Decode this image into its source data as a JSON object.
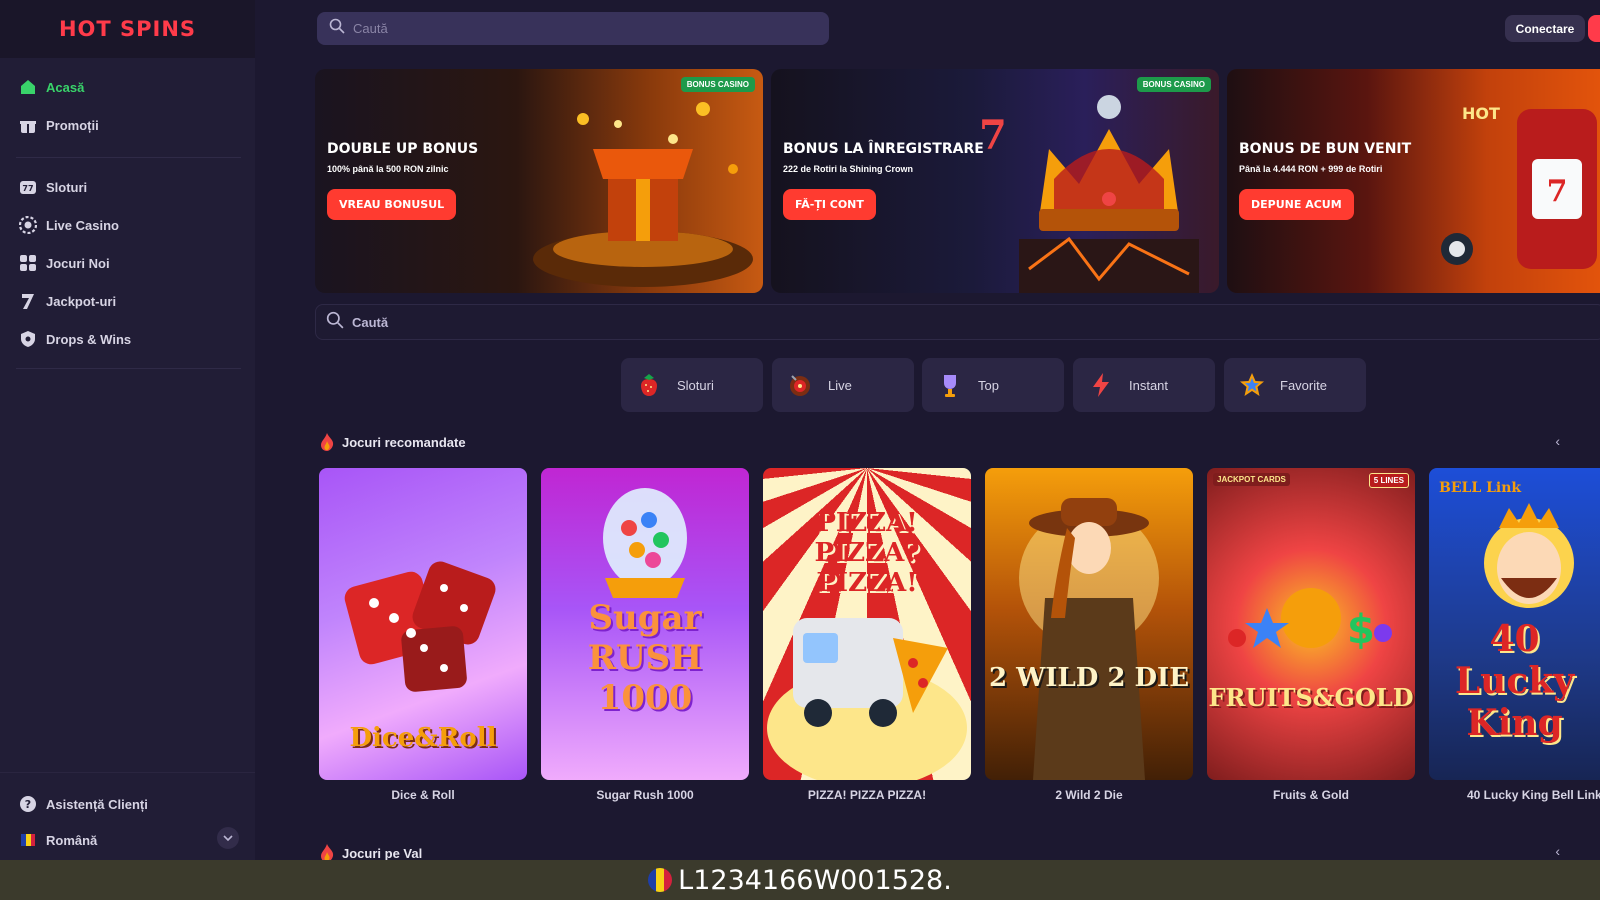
{
  "brand": {
    "logo_text": "HOT SPINS"
  },
  "topbar": {
    "search_placeholder": "Caută",
    "login_label": "Conectare"
  },
  "sidebar": {
    "items_top": [
      {
        "label": "Acasă",
        "icon": "home-icon",
        "active": true
      },
      {
        "label": "Promoții",
        "icon": "gift-icon",
        "active": false
      }
    ],
    "items_games": [
      {
        "label": "Sloturi",
        "icon": "slot-machine-icon"
      },
      {
        "label": "Live Casino",
        "icon": "chip-icon"
      },
      {
        "label": "Jocuri Noi",
        "icon": "grid-icon"
      },
      {
        "label": "Jackpot-uri",
        "icon": "seven-icon"
      },
      {
        "label": "Drops & Wins",
        "icon": "shield-icon"
      }
    ],
    "support_label": "Asistență Clienți",
    "language_label": "Română"
  },
  "banners": [
    {
      "tag": "BONUS CASINO",
      "title": "DOUBLE UP BONUS",
      "subtitle": "100% până la 500 RON zilnic",
      "button": "VREAU BONUSUL",
      "accent": "#ff3b30"
    },
    {
      "tag": "BONUS CASINO",
      "title": "BONUS LA ÎNREGISTRARE",
      "subtitle": "222 de Rotiri la Shining Crown",
      "button": "FĂ-ȚI CONT",
      "accent": "#ff3b30"
    },
    {
      "title": "BONUS DE BUN VENIT",
      "subtitle": "Până la 4.444 RON + 999 de Rotiri",
      "button": "DEPUNE ACUM",
      "accent": "#ff3b30"
    }
  ],
  "main_search": {
    "placeholder": "Caută"
  },
  "categories": [
    {
      "label": "Sloturi",
      "icon": "strawberry-icon"
    },
    {
      "label": "Live",
      "icon": "roulette-icon"
    },
    {
      "label": "Top",
      "icon": "trophy-icon"
    },
    {
      "label": "Instant",
      "icon": "lightning-icon"
    },
    {
      "label": "Favorite",
      "icon": "star-icon"
    }
  ],
  "sections": {
    "recommended_title": "Jocuri recomandate",
    "wave_title": "Jocuri pe Val"
  },
  "games": [
    {
      "name": "Dice & Roll",
      "art_text": "Dice&Roll"
    },
    {
      "name": "Sugar Rush 1000",
      "art_text": "Sugar RUSH 1000"
    },
    {
      "name": "PIZZA! PIZZA PIZZA!",
      "art_text": "PIZZA! PIZZA? PIZZA!"
    },
    {
      "name": "2 Wild 2 Die",
      "art_text": "2 WILD 2 DIE"
    },
    {
      "name": "Fruits & Gold",
      "art_text": "FRUITS&GOLD",
      "badge_left": "JACKPOT CARDS",
      "badge_right": "5 LINES"
    },
    {
      "name": "40 Lucky King Bell Link",
      "art_text": "40 Lucky King",
      "badge_left": "BELL Link"
    }
  ],
  "subtitle": "L1234166W001528."
}
